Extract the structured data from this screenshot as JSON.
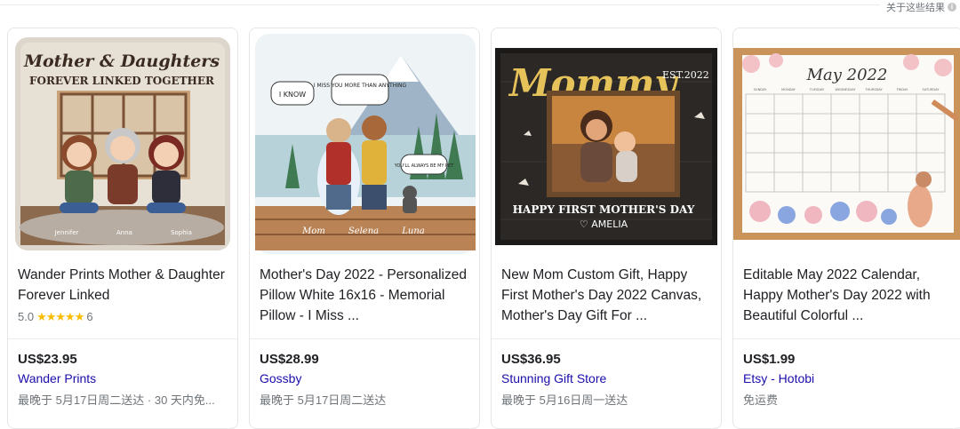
{
  "header": {
    "about_label": "关于这些结果"
  },
  "products": [
    {
      "image_alt": "Wander Prints pillow",
      "image_text": {
        "line1": "Mother & Daughters",
        "line2": "FOREVER LINKED TOGETHER",
        "names": [
          "Jennifer",
          "Anna",
          "Sophia"
        ]
      },
      "title": "Wander Prints Mother & Daughter Forever Linked",
      "rating": "5.0",
      "stars": "★★★★★",
      "reviews": "6",
      "price": "US$23.95",
      "store": "Wander Prints",
      "delivery": "最晚于 5月17日周二送达 · 30 天内免..."
    },
    {
      "image_text": {
        "bubble1": "I KNOW",
        "bubble2": "I MISS YOU MORE THAN ANYTHING",
        "bubble3": "YOU'LL ALWAYS BE MY PET",
        "names": [
          "Mom",
          "Selena",
          "Luna"
        ]
      },
      "title": "Mother's Day 2022 - Personalized Pillow White 16x16 - Memorial Pillow - I Miss ...",
      "price": "US$28.99",
      "store": "Gossby",
      "delivery": "最晚于 5月17日周二送达"
    },
    {
      "image_text": {
        "word": "Mommy",
        "est": "EST.2022",
        "caption": "HAPPY FIRST MOTHER'S DAY",
        "name": "♡ AMELIA"
      },
      "title": "New Mom Custom Gift, Happy First Mother's Day 2022 Canvas, Mother's Day Gift For ...",
      "price": "US$36.95",
      "store": "Stunning Gift Store",
      "delivery": "最晚于 5月16日周一送达"
    },
    {
      "image_text": {
        "month": "May 2022",
        "days": [
          "SUNDAY",
          "MONDAY",
          "TUESDAY",
          "WEDNESDAY",
          "THURSDAY",
          "FRIDAY",
          "SATURDAY"
        ]
      },
      "title": "Editable May 2022 Calendar, Happy Mother's Day 2022 with Beautiful Colorful ...",
      "price": "US$1.99",
      "store": "Etsy - Hotobi",
      "delivery": "免运费"
    }
  ],
  "colors": {
    "link": "#1a0dab",
    "star": "#fbbc04",
    "muted": "#70757a"
  }
}
